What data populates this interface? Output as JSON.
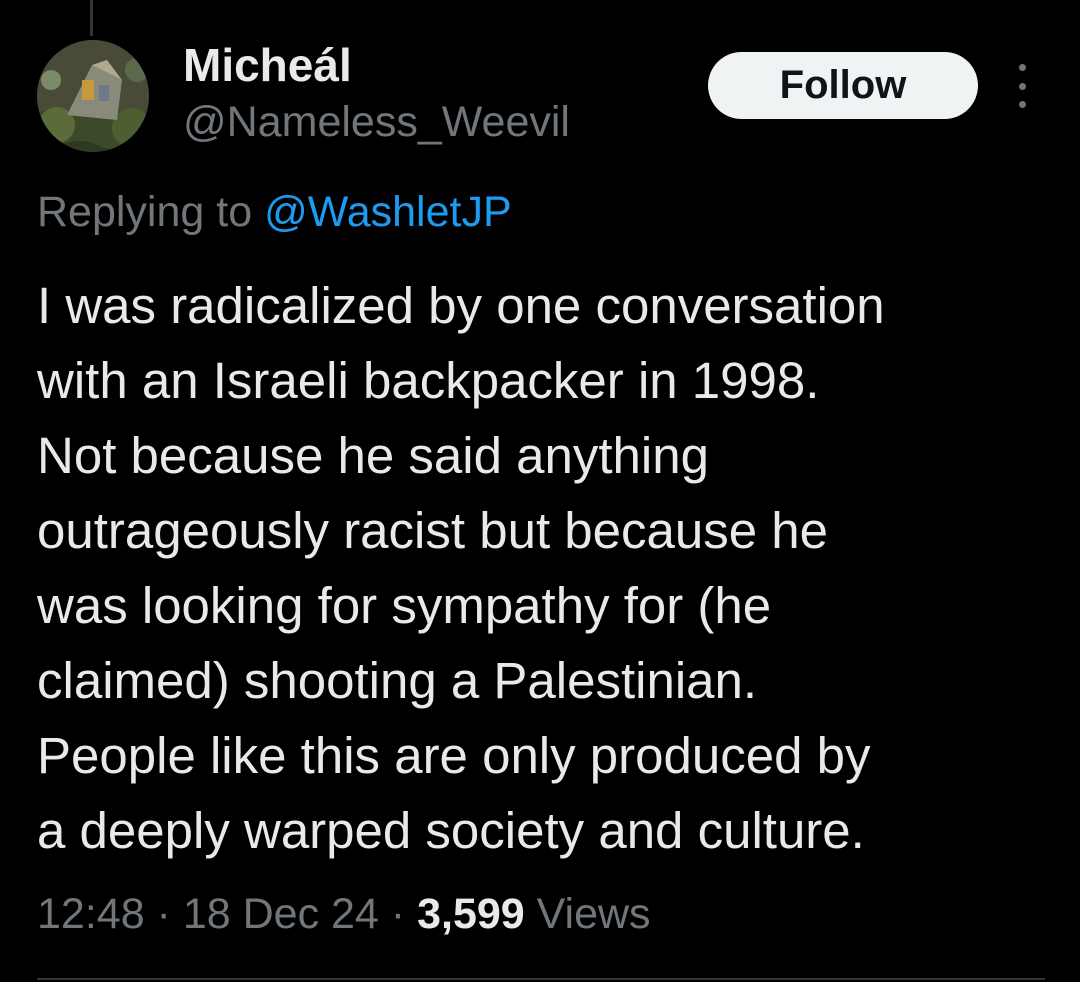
{
  "author": {
    "display_name": "Micheál",
    "handle": "@Nameless_Weevil",
    "avatar_icon": "avatar-photo"
  },
  "actions": {
    "follow_label": "Follow",
    "more_icon": "more-vertical-icon"
  },
  "reply": {
    "prefix": "Replying to ",
    "mention": "@WashletJP"
  },
  "tweet": {
    "lines": [
      "I was radicalized by one conversation",
      "with an Israeli backpacker in 1998.",
      "Not because he said anything",
      "outrageously racist but because he",
      "was looking for sympathy for (he",
      "claimed) shooting a Palestinian.",
      "People like this are only produced by",
      "a deeply warped society and culture."
    ]
  },
  "meta": {
    "time": "12:48",
    "separator": " · ",
    "date": "18 Dec 24",
    "views_count": "3,599",
    "views_label": " Views"
  },
  "colors": {
    "background": "#000000",
    "text_primary": "#e7e9ea",
    "text_secondary": "#71767b",
    "link": "#1d9bf0",
    "follow_bg": "#eff3f4"
  }
}
